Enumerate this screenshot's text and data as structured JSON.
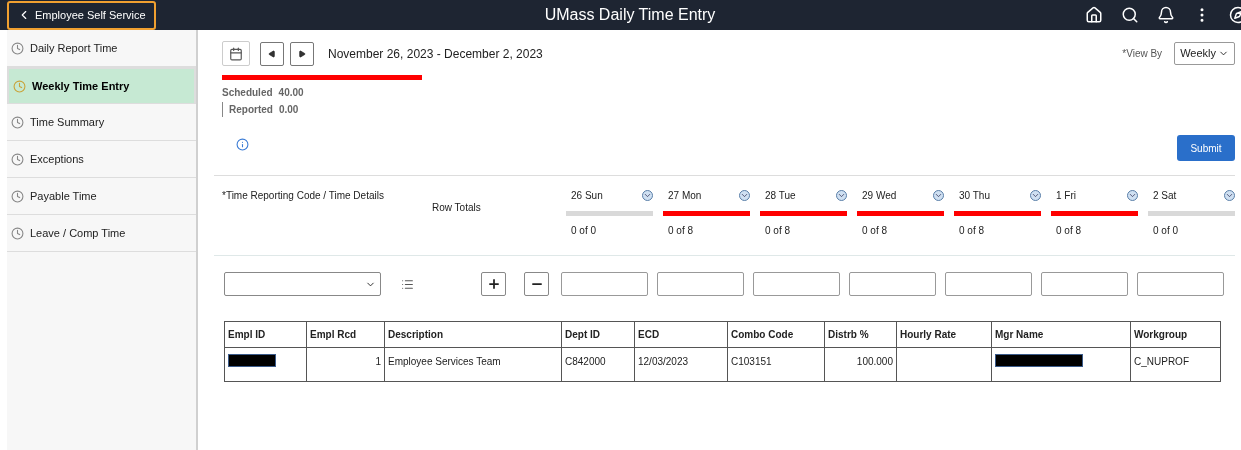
{
  "header": {
    "back_label": "Employee Self Service",
    "title": "UMass Daily Time Entry"
  },
  "sidebar": {
    "items": [
      {
        "label": "Daily Report Time",
        "selected": false
      },
      {
        "label": "Weekly Time Entry",
        "selected": true
      },
      {
        "label": "Time Summary",
        "selected": false
      },
      {
        "label": "Exceptions",
        "selected": false
      },
      {
        "label": "Payable Time",
        "selected": false
      },
      {
        "label": "Leave / Comp Time",
        "selected": false
      }
    ]
  },
  "period": {
    "date_range": "November 26, 2023 - December 2, 2023",
    "scheduled_label": "Scheduled",
    "scheduled_value": "40.00",
    "reported_label": "Reported",
    "reported_value": "0.00"
  },
  "view_by": {
    "label": "*View By",
    "value": "Weekly"
  },
  "submit_label": "Submit",
  "grid": {
    "code_label": "*Time Reporting Code / Time Details",
    "totals_label": "Row Totals",
    "days": [
      {
        "label": "26 Sun",
        "total": "0 of 0",
        "color": "#d9d9d9"
      },
      {
        "label": "27 Mon",
        "total": "0 of 8",
        "color": "#ff0000"
      },
      {
        "label": "28 Tue",
        "total": "0 of 8",
        "color": "#ff0000"
      },
      {
        "label": "29 Wed",
        "total": "0 of 8",
        "color": "#ff0000"
      },
      {
        "label": "30 Thu",
        "total": "0 of 8",
        "color": "#ff0000"
      },
      {
        "label": "1 Fri",
        "total": "0 of 8",
        "color": "#ff0000"
      },
      {
        "label": "2 Sat",
        "total": "0 of 0",
        "color": "#d9d9d9"
      }
    ]
  },
  "table": {
    "columns": [
      "Empl ID",
      "Empl Rcd",
      "Description",
      "Dept ID",
      "ECD",
      "Combo Code",
      "Distrb %",
      "Hourly Rate",
      "Mgr Name",
      "Workgroup"
    ],
    "rows": [
      [
        {
          "kind": "redacted"
        },
        {
          "text": "1",
          "kind": "number"
        },
        {
          "text": "Employee Services Team"
        },
        {
          "text": "C842000"
        },
        {
          "text": "12/03/2023"
        },
        {
          "text": "C103151"
        },
        {
          "text": "100.000",
          "kind": "number"
        },
        {
          "kind": "empty"
        },
        {
          "kind": "redacted"
        },
        {
          "text": "C_NUPROF"
        }
      ]
    ]
  }
}
